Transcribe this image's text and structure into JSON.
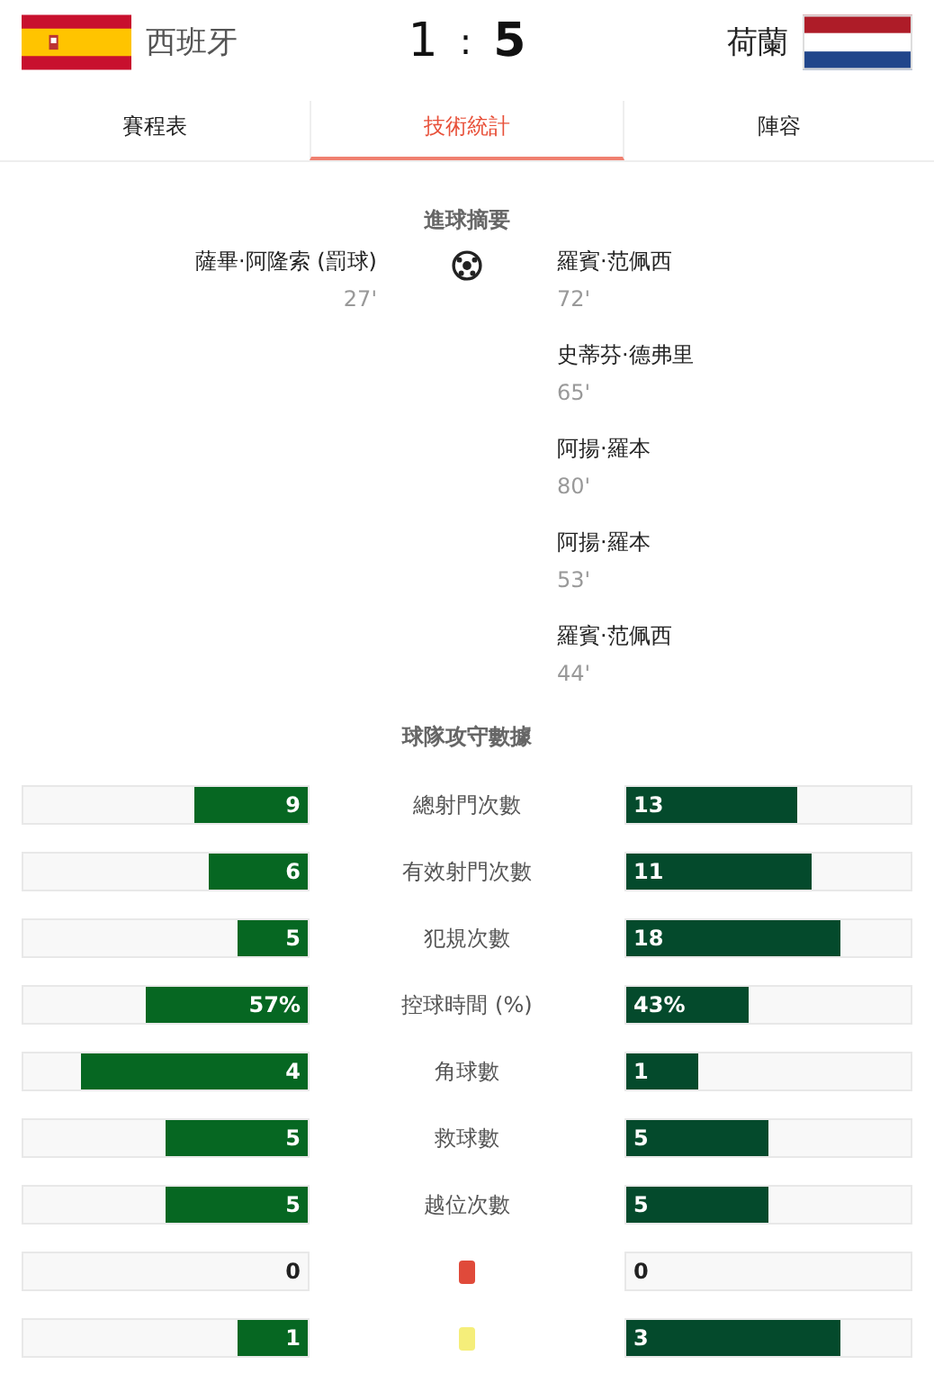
{
  "match": {
    "home": {
      "name": "西班牙",
      "score": "1"
    },
    "separator": ":",
    "away": {
      "name": "荷蘭",
      "score": "5"
    }
  },
  "tabs": [
    {
      "label": "賽程表",
      "selected": false
    },
    {
      "label": "技術統計",
      "selected": true
    },
    {
      "label": "陣容",
      "selected": false
    }
  ],
  "goals": {
    "title": "進球摘要",
    "home": [
      {
        "player": "薩畢·阿隆索 (罰球)",
        "minute": "27'"
      }
    ],
    "away": [
      {
        "player": "羅賓·范佩西",
        "minute": "72'"
      },
      {
        "player": "史蒂芬·德弗里",
        "minute": "65'"
      },
      {
        "player": "阿揚·羅本",
        "minute": "80'"
      },
      {
        "player": "阿揚·羅本",
        "minute": "53'"
      },
      {
        "player": "羅賓·范佩西",
        "minute": "44'"
      }
    ]
  },
  "stats": {
    "title": "球隊攻守數據",
    "rows": [
      {
        "kind": "text",
        "label": "總射門次數",
        "home": {
          "value": "9",
          "level": 0.4
        },
        "away": {
          "value": "13",
          "level": 0.6
        }
      },
      {
        "kind": "text",
        "label": "有效射門次數",
        "home": {
          "value": "6",
          "level": 0.35
        },
        "away": {
          "value": "11",
          "level": 0.65
        }
      },
      {
        "kind": "text",
        "label": "犯規次數",
        "home": {
          "value": "5",
          "level": 0.25
        },
        "away": {
          "value": "18",
          "level": 0.75
        }
      },
      {
        "kind": "text",
        "label": "控球時間 (%)",
        "home": {
          "value": "57%",
          "level": 0.57
        },
        "away": {
          "value": "43%",
          "level": 0.43
        }
      },
      {
        "kind": "text",
        "label": "角球數",
        "home": {
          "value": "4",
          "level": 0.8
        },
        "away": {
          "value": "1",
          "level": 0.25
        }
      },
      {
        "kind": "text",
        "label": "救球數",
        "home": {
          "value": "5",
          "level": 0.5
        },
        "away": {
          "value": "5",
          "level": 0.5
        }
      },
      {
        "kind": "text",
        "label": "越位次數",
        "home": {
          "value": "5",
          "level": 0.5
        },
        "away": {
          "value": "5",
          "level": 0.5
        }
      },
      {
        "kind": "card",
        "color": "#e04a3a",
        "home": {
          "value": "0"
        },
        "away": {
          "value": "0"
        }
      },
      {
        "kind": "card",
        "color": "#f5ee7a",
        "home": {
          "value": "1",
          "level": 0.25
        },
        "away": {
          "value": "3",
          "level": 0.75
        }
      }
    ]
  }
}
